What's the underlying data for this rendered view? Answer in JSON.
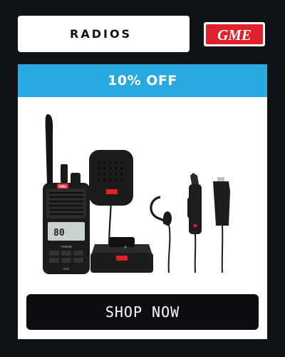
{
  "header": {
    "title": "RADIOS",
    "brand_logo_text": "GME",
    "brand_color": "#e0202a"
  },
  "promo": {
    "label": "10% OFF",
    "color": "#29a9e0"
  },
  "product": {
    "radio_screen_text": "80",
    "radio_model_label": "TX6160",
    "radio_brand_badge": "GME",
    "radio_bottom_label": "GME"
  },
  "cta": {
    "label": "SHOP NOW"
  }
}
